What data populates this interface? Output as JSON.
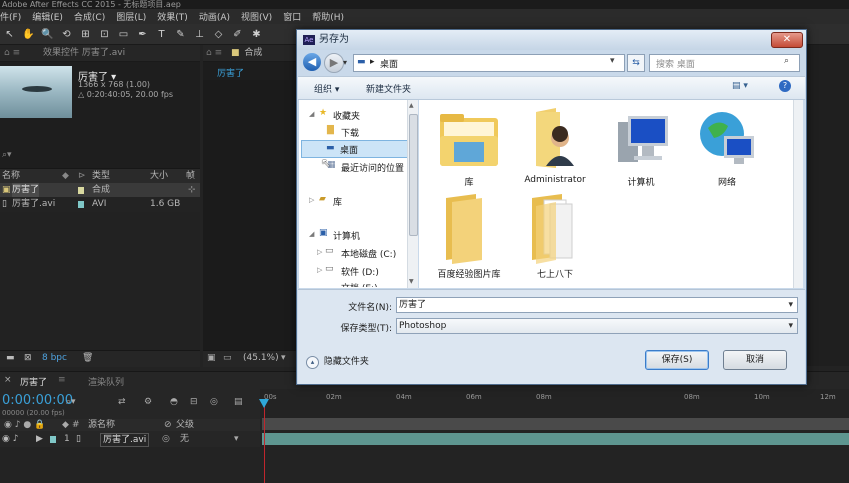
{
  "app": {
    "title": "Adobe After Effects CC 2015 - 无标题项目.aep",
    "menu": [
      "件(F)",
      "编辑(E)",
      "合成(C)",
      "图层(L)",
      "效果(T)",
      "动画(A)",
      "视图(V)",
      "窗口",
      "帮助(H)"
    ]
  },
  "project_panel": {
    "tab_label": "效果控件 厉害了.avi",
    "item_name": "厉害了 ▾",
    "item_size": "1366 x 768 (1.00)",
    "item_duration": "△ 0:20:40:05, 20.00 fps",
    "columns": [
      "名称",
      "类型",
      "大小",
      "帧"
    ],
    "rows": [
      {
        "name": "厉害了",
        "type": "合成",
        "size": "",
        "color": "#d9d9a0"
      },
      {
        "name": "厉害了.avi",
        "type": "AVI",
        "size": "1.6 GB",
        "color": "#7fc7c7"
      }
    ],
    "bpc": "8 bpc"
  },
  "comp_panel": {
    "tab_label": "合成",
    "comp_name": "厉害了",
    "zoom": "(45.1%)"
  },
  "timeline": {
    "tab_label": "厉害了",
    "render_queue": "渲染队列",
    "time": "0:00:00:00",
    "fps": "00000 (20.00 fps)",
    "col_source": "源名称",
    "col_parent": "父级",
    "layer_index": "1",
    "layer_name": "厉害了.avi",
    "parent_value": "无",
    "ticks": [
      "00s",
      "02m",
      "04m",
      "06m",
      "08m",
      "08m",
      "10m",
      "12m"
    ]
  },
  "dialog": {
    "title": "另存为",
    "close_label": "✕",
    "address": "桌面",
    "search_placeholder": "搜索 桌面",
    "organize": "组织 ▾",
    "new_folder": "新建文件夹",
    "nav": {
      "favorites": "收藏夹",
      "downloads": "下载",
      "desktop": "桌面",
      "recent": "最近访问的位置",
      "library": "库",
      "computer": "计算机",
      "local_disk": "本地磁盘 (C:)",
      "soft_disk": "软件 (D:)",
      "doc_disk": "文档 (E:)"
    },
    "files": [
      "库",
      "Administrator",
      "计算机",
      "网络",
      "百度经验图片库",
      "七上八下"
    ],
    "filename_label": "文件名(N):",
    "filename_value": "厉害了",
    "filetype_label": "保存类型(T):",
    "filetype_value": "Photoshop",
    "hide_folders": "隐藏文件夹",
    "save_button": "保存(S)",
    "cancel_button": "取消"
  }
}
